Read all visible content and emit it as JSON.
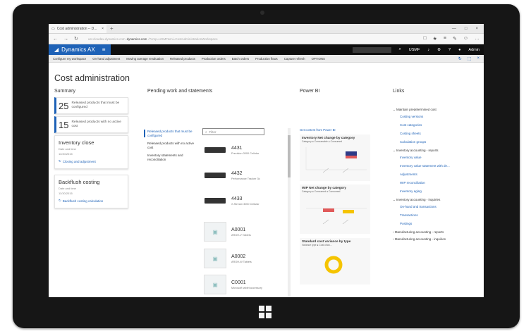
{
  "browser": {
    "tab_title": "Cost administration -- D...",
    "tab_close": "×",
    "new_tab": "+",
    "window_controls": [
      "—",
      "□",
      "×"
    ],
    "nav": [
      "←",
      "→",
      "↻"
    ],
    "url_prefix": "usr.cloudax.dynamics.com",
    "url_domain": "dynamics.com",
    "url_suffix": "/?cmp=USMF&mi=CostAdministrationWorkspace",
    "toolbar_icons": [
      "□",
      "★",
      "≡",
      "✎",
      "☺",
      "…"
    ]
  },
  "app": {
    "brand": "Dynamics AX",
    "menu_glyph": "≡",
    "search_placeholder": "",
    "company": "USMF",
    "user": "Admin",
    "icons": [
      "♪",
      "⚙",
      "?",
      "●"
    ]
  },
  "nav": {
    "items": [
      "Configure my workspace",
      "On-hand adjustment",
      "Moving average revaluation",
      "Released products",
      "Production orders",
      "Batch orders",
      "Production flows",
      "Capture refresh",
      "OPTIONS"
    ],
    "tools": [
      "↻",
      "⬚",
      "×"
    ]
  },
  "page": {
    "title": "Cost administration"
  },
  "summary": {
    "heading": "Summary",
    "counts": [
      {
        "value": "25",
        "label": "Released products that must be configured"
      },
      {
        "value": "15",
        "label": "Released products with no active cost"
      }
    ],
    "workflows": [
      {
        "title": "Inventory close",
        "sub1": "Date and time",
        "sub2": "11/30/2015",
        "link": "Closing and adjustment"
      },
      {
        "title": "Backflush costing",
        "sub1": "Date and time",
        "sub2": "11/30/2015",
        "link": "Backflush costing calculation"
      }
    ]
  },
  "pending": {
    "heading": "Pending work and statements",
    "list": [
      "Released products that must be configured",
      "Released products with no active cost",
      "Inventory statements and reconciliation"
    ],
    "filter_placeholder": "Filter",
    "products": [
      {
        "code": "4431",
        "desc": "Precision 3000 Cellular"
      },
      {
        "code": "4432",
        "desc": "Performance Tracker 3k"
      },
      {
        "code": "4433",
        "desc": "X-Stream 3000 Cellular"
      },
      {
        "code": "A0001",
        "desc": "ARGH-V Tablets"
      },
      {
        "code": "A0002",
        "desc": "ARGH-W Tablets"
      },
      {
        "code": "C0001",
        "desc": "Microsoft tablet accessory"
      }
    ]
  },
  "powerbi": {
    "heading": "Power BI",
    "link": "Get content from Power BI",
    "cards": [
      {
        "title": "Inventory Net change by category",
        "legend": "Category  ● Consumable  ● Consumed"
      },
      {
        "title": "WIP Net change by category",
        "legend": "Category  ● Consumed  ● Consumed"
      },
      {
        "title": "Standard cost variance by type",
        "legend": "Variance type  ● Cost chan..."
      }
    ]
  },
  "links": {
    "heading": "Links",
    "groups": [
      {
        "name": "Maintain predetermined cost",
        "items": [
          "Costing versions",
          "Cost categories",
          "Costing sheets",
          "Calculation groups"
        ]
      },
      {
        "name": "Inventory accounting - reports",
        "items": [
          "Inventory value",
          "Inventory value statement with de...",
          "Adjustments",
          "WIP reconciliation",
          "Inventory aging"
        ]
      },
      {
        "name": "Inventory accounting - inquiries",
        "items": [
          "On-hand and transactions",
          "Transactions",
          "Postings"
        ]
      },
      {
        "name": "Manufacturing accounting - reports",
        "items": []
      },
      {
        "name": "Manufacturing accounting - inquiries",
        "items": []
      }
    ]
  },
  "colors": {
    "brand": "#1e62b7",
    "appbar": "#0f0f0f",
    "accent_yellow": "#f5c400",
    "chart_navy": "#2e3a87",
    "chart_red": "#e05a5a"
  }
}
